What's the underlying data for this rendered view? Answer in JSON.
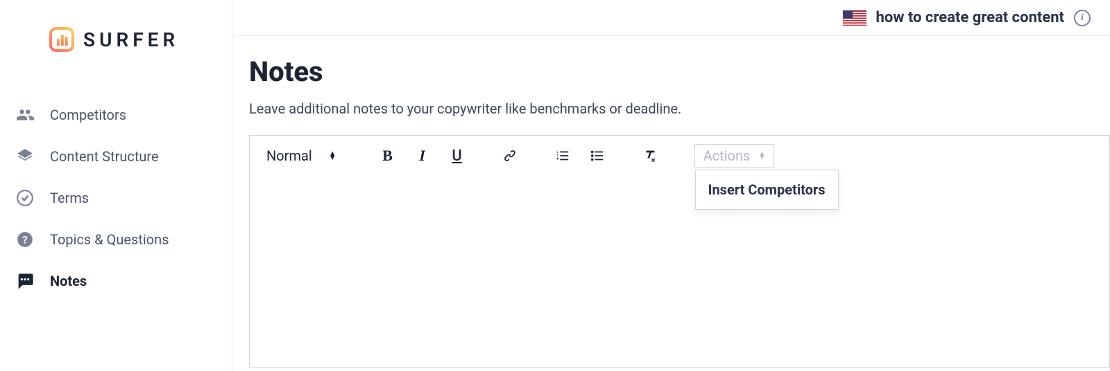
{
  "brand": {
    "name": "SURFER"
  },
  "sidebar": {
    "items": [
      {
        "label": "Competitors"
      },
      {
        "label": "Content Structure"
      },
      {
        "label": "Terms"
      },
      {
        "label": "Topics & Questions"
      },
      {
        "label": "Notes"
      }
    ]
  },
  "header": {
    "query": "how to create great content"
  },
  "page": {
    "title": "Notes",
    "subtitle": "Leave additional notes to your copywriter like benchmarks or deadline."
  },
  "editor": {
    "format_label": "Normal",
    "actions_label": "Actions",
    "actions_menu": [
      {
        "label": "Insert Competitors"
      }
    ]
  }
}
